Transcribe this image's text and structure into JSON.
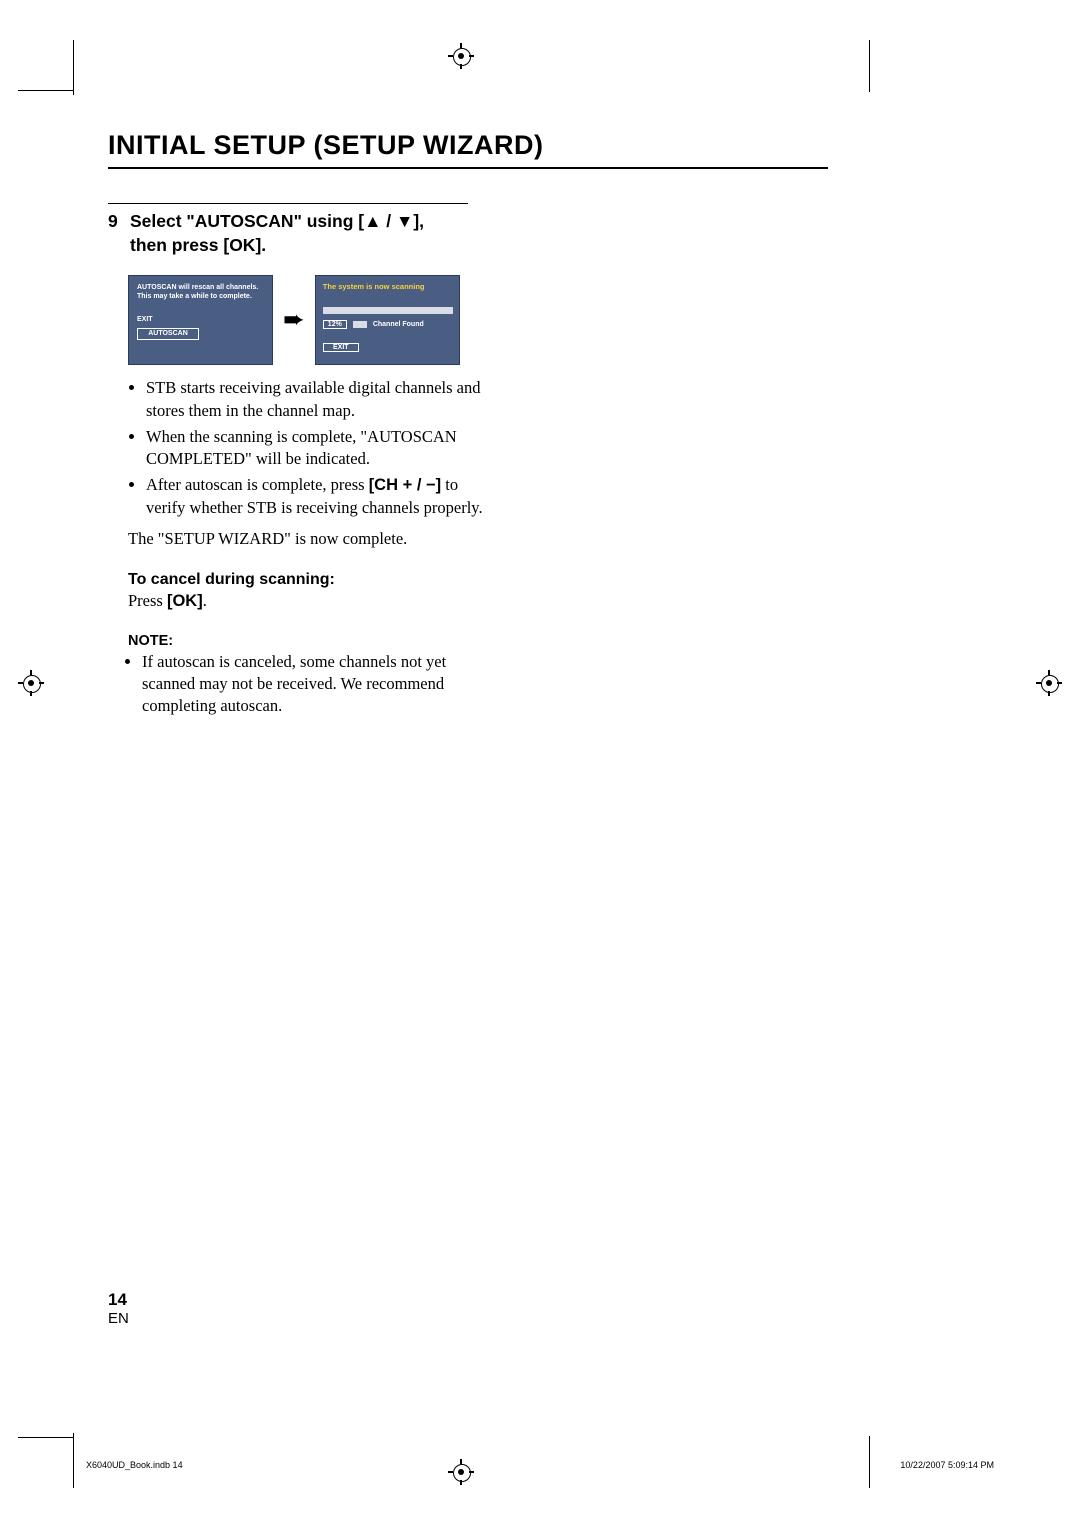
{
  "header": {
    "title": "INITIAL SETUP (SETUP WIZARD)"
  },
  "step": {
    "number": "9",
    "line1_prefix": "Select \"AUTOSCAN\" using [",
    "arrow_up": "▲",
    "arrow_sep": " / ",
    "arrow_down": "▼",
    "line1_suffix": "],",
    "line2": "then press [OK]."
  },
  "osd1": {
    "msg_line1": "AUTOSCAN will rescan all channels.",
    "msg_line2": "This may take a while to complete.",
    "exit_label": "EXIT",
    "autoscan_btn": "AUTOSCAN"
  },
  "arrow_between": "➨",
  "osd2": {
    "title": "The system is now scanning",
    "percent": "12%",
    "channel_found": "Channel Found",
    "exit_btn": "EXIT"
  },
  "bullets1": [
    "STB starts receiving available digital channels and stores them in the channel map.",
    "When the scanning is complete, \"AUTOSCAN COMPLETED\" will be indicated."
  ],
  "bullet3_prefix": "After autoscan is complete, press ",
  "bullet3_bold": "[CH + / −]",
  "bullet3_suffix": " to verify whether STB is receiving channels properly.",
  "wizard_complete": "The \"SETUP WIZARD\" is now complete.",
  "cancel_heading": "To cancel during scanning:",
  "cancel_press_prefix": "Press ",
  "cancel_press_bold": "[OK]",
  "cancel_press_suffix": ".",
  "note_heading": "NOTE:",
  "note_bullet": "If autoscan is canceled, some channels not yet scanned may not be received. We recommend completing autoscan.",
  "footer": {
    "page_number": "14",
    "lang": "EN",
    "imprint_file": "X6040UD_Book.indb   14",
    "imprint_datetime": "10/22/2007   5:09:14 PM"
  }
}
